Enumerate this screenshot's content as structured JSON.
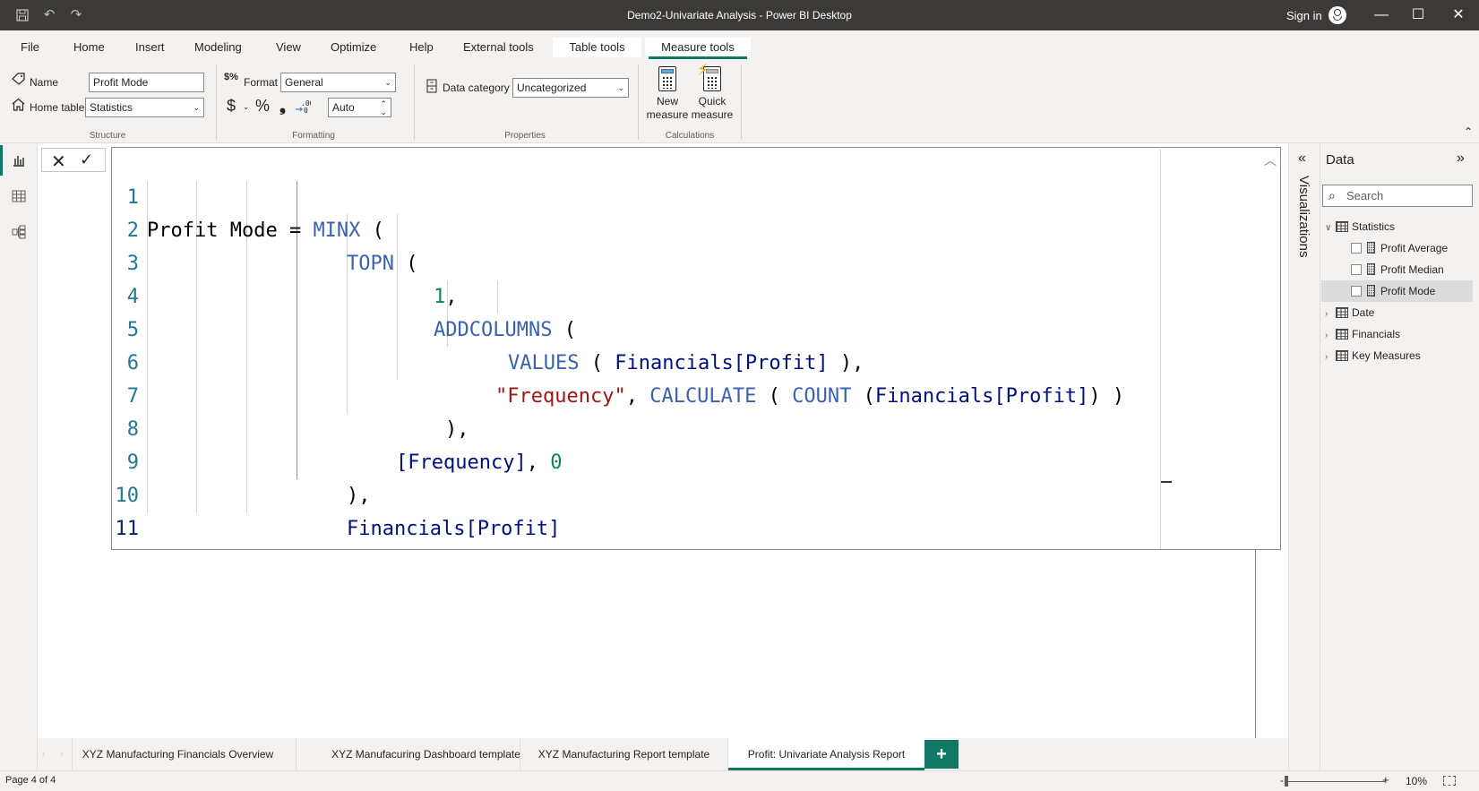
{
  "titlebar": {
    "title": "Demo2-Univariate Analysis - Power BI Desktop",
    "sign_in": "Sign in",
    "icons": [
      "save-icon",
      "undo-icon",
      "redo-icon",
      "account-icon",
      "minimize-icon",
      "maximize-icon",
      "close-icon"
    ]
  },
  "ribbon": {
    "tabs": [
      {
        "label": "File"
      },
      {
        "label": "Home"
      },
      {
        "label": "Insert"
      },
      {
        "label": "Modeling"
      },
      {
        "label": "View"
      },
      {
        "label": "Optimize"
      },
      {
        "label": "Help"
      },
      {
        "label": "External tools"
      },
      {
        "label": "Table tools"
      },
      {
        "label": "Measure tools",
        "active": true
      }
    ],
    "structure": {
      "group_label": "Structure",
      "name_label": "Name",
      "name_value": "Profit Mode",
      "home_table_label": "Home table",
      "home_table_value": "Statistics"
    },
    "formatting": {
      "group_label": "Formatting",
      "format_label": "Format",
      "format_value": "General",
      "currency_symbol": "$",
      "percent_symbol": "%",
      "comma_symbol": "❟",
      "decimal_value": "Auto"
    },
    "properties": {
      "group_label": "Properties",
      "data_category_label": "Data category",
      "data_category_value": "Uncategorized"
    },
    "calculations": {
      "group_label": "Calculations",
      "new_measure_line1": "New",
      "new_measure_line2": "measure",
      "quick_measure_line1": "Quick",
      "quick_measure_line2": "measure"
    }
  },
  "formula": {
    "lines": [
      {
        "n": "1"
      },
      {
        "n": "2"
      },
      {
        "n": "3"
      },
      {
        "n": "4"
      },
      {
        "n": "5"
      },
      {
        "n": "6"
      },
      {
        "n": "7"
      },
      {
        "n": "8"
      },
      {
        "n": "9"
      },
      {
        "n": "10"
      },
      {
        "n": "11"
      }
    ],
    "tokens": {
      "l1_name": "Profit Mode = ",
      "l1_fn": "MINX",
      "l1_rest": " (",
      "l2_fn": "TOPN",
      "l2_rest": " (",
      "l3_num": "1",
      "l3_rest": ",",
      "l4_fn": "ADDCOLUMNS",
      "l4_rest": " (",
      "l5_fn": "VALUES",
      "l5_a": " ( ",
      "l5_col": "Financials[Profit]",
      "l5_b": " ),",
      "l6_str": "\"Frequency\"",
      "l6_a": ", ",
      "l6_fn1": "CALCULATE",
      "l6_b": " ( ",
      "l6_fn2": "COUNT",
      "l6_c": " (",
      "l6_col": "Financials[Profit]",
      "l6_d": ") )",
      "l7": "),",
      "l8_col": "[Frequency]",
      "l8_a": ", ",
      "l8_num": "0",
      "l9": "),",
      "l10_col": "Financials[Profit]",
      "l11": ")"
    }
  },
  "visualizations_pane": {
    "label": "Visualizations"
  },
  "data_pane": {
    "title": "Data",
    "search_placeholder": "Search",
    "tree": [
      {
        "label": "Statistics",
        "type": "measure-table",
        "expanded": true,
        "children": [
          {
            "label": "Profit Average",
            "checked": false
          },
          {
            "label": "Profit Median",
            "checked": false
          },
          {
            "label": "Profit Mode",
            "checked": false,
            "selected": true
          }
        ]
      },
      {
        "label": "Date",
        "type": "table",
        "expanded": false
      },
      {
        "label": "Financials",
        "type": "table",
        "expanded": false
      },
      {
        "label": "Key Measures",
        "type": "measure-table",
        "expanded": false
      }
    ]
  },
  "page_tabs": {
    "tabs": [
      {
        "label": "XYZ Manufacturing Financials Overview"
      },
      {
        "label": "XYZ Manufacuring Dashboard template"
      },
      {
        "label": "XYZ Manufacturing Report template"
      },
      {
        "label": "Profit: Univariate Analysis Report",
        "active": true
      }
    ],
    "add_label": "+"
  },
  "status": {
    "page": "Page 4 of 4",
    "zoom": "10%",
    "zoom_minus": "-",
    "zoom_plus": "+"
  },
  "colors": {
    "accent": "#117865",
    "titlebar": "#3b3a39",
    "keyword": "#3a62b0",
    "string": "#a31515",
    "number": "#098658",
    "column": "#001080",
    "line_number": "#237893"
  }
}
